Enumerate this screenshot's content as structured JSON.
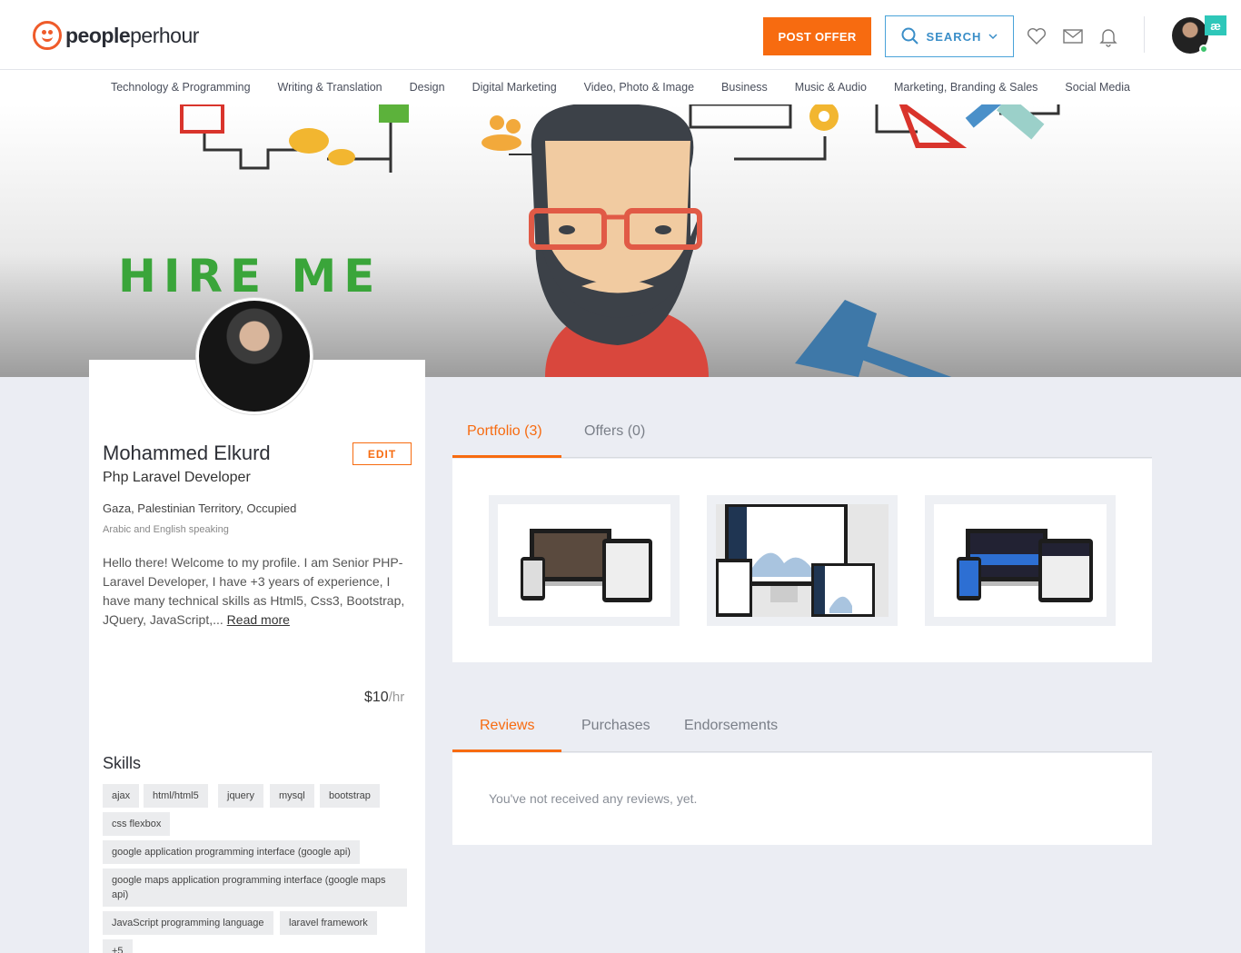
{
  "brand": {
    "part1": "people",
    "part2": "perhour"
  },
  "header": {
    "post_offer": "POST OFFER",
    "search": "SEARCH",
    "badge": "æ"
  },
  "categories": [
    "Technology & Programming",
    "Writing & Translation",
    "Design",
    "Digital Marketing",
    "Video, Photo & Image",
    "Business",
    "Music & Audio",
    "Marketing, Branding & Sales",
    "Social Media"
  ],
  "banner": {
    "text": "HIRE ME"
  },
  "profile": {
    "name": "Mohammed Elkurd",
    "title": "Php Laravel Developer",
    "edit": "EDIT",
    "location": "Gaza, Palestinian Territory, Occupied",
    "languages": "Arabic and English speaking",
    "bio": "Hello there! Welcome to my profile. I am Senior PHP-Laravel Developer, I have +3 years of experience, I have many technical skills as Html5, Css3, Bootstrap, JQuery, JavaScript,...",
    "read_more": "Read more",
    "rate": "$10",
    "rate_unit": "/hr"
  },
  "skills": {
    "title": "Skills",
    "items": [
      "ajax",
      "html/html5",
      "jquery",
      "mysql",
      "bootstrap",
      "css flexbox",
      "google application programming interface (google api)",
      "google maps application programming interface (google maps api)",
      "JavaScript programming language",
      "laravel framework",
      "+5"
    ]
  },
  "tabs_top": [
    {
      "label": "Portfolio (3)"
    },
    {
      "label": "Offers (0)"
    }
  ],
  "tabs_bottom": [
    {
      "label": "Reviews"
    },
    {
      "label": "Purchases"
    },
    {
      "label": "Endorsements"
    }
  ],
  "reviews": {
    "empty": "You've not received any reviews, yet."
  },
  "colors": {
    "accent": "#f76b10",
    "search_border": "#4aa3d9",
    "online": "#3cc36b"
  }
}
